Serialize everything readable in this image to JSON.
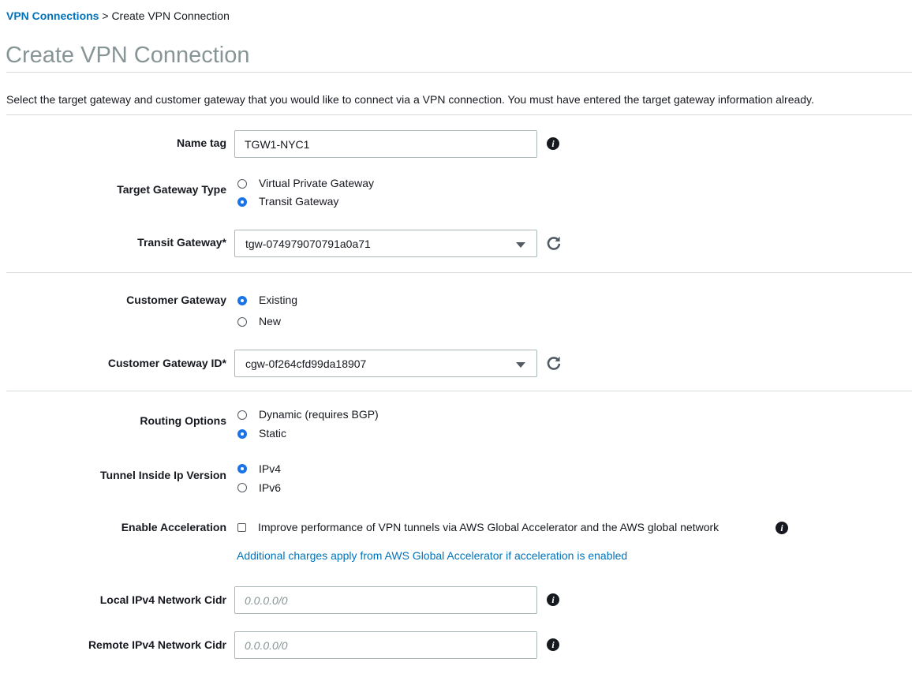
{
  "breadcrumb": {
    "parent": "VPN Connections",
    "separator": " > ",
    "current": "Create VPN Connection"
  },
  "page": {
    "title": "Create VPN Connection",
    "description": "Select the target gateway and customer gateway that you would like to connect via a VPN connection. You must have entered the target gateway information already."
  },
  "form": {
    "name_tag": {
      "label": "Name tag",
      "value": "TGW1-NYC1",
      "info_icon": "info-icon"
    },
    "target_gateway_type": {
      "label": "Target Gateway Type",
      "options": [
        "Virtual Private Gateway",
        "Transit Gateway"
      ],
      "selected": "Transit Gateway"
    },
    "transit_gateway": {
      "label": "Transit Gateway*",
      "value": "tgw-074979070791a0a71",
      "refresh_icon": "refresh-icon"
    },
    "customer_gateway": {
      "label": "Customer Gateway",
      "options": [
        "Existing",
        "New"
      ],
      "selected": "Existing"
    },
    "customer_gateway_id": {
      "label": "Customer Gateway ID*",
      "value": "cgw-0f264cfd99da18907",
      "refresh_icon": "refresh-icon"
    },
    "routing_options": {
      "label": "Routing Options",
      "options": [
        "Dynamic (requires BGP)",
        "Static"
      ],
      "selected": "Static"
    },
    "tunnel_ip_version": {
      "label": "Tunnel Inside Ip Version",
      "options": [
        "IPv4",
        "IPv6"
      ],
      "selected": "IPv4"
    },
    "enable_acceleration": {
      "label": "Enable Acceleration",
      "checkbox_label": "Improve performance of VPN tunnels via AWS Global Accelerator and the AWS global network",
      "checked": false,
      "note": "Additional charges apply from AWS Global Accelerator if acceleration is enabled"
    },
    "local_cidr": {
      "label": "Local IPv4 Network Cidr",
      "value": "",
      "placeholder": "0.0.0.0/0"
    },
    "remote_cidr": {
      "label": "Remote IPv4 Network Cidr",
      "value": "",
      "placeholder": "0.0.0.0/0"
    }
  },
  "colors": {
    "link": "#0073bb",
    "radio_selected": "#1a73e8",
    "title": "#879596",
    "divider": "#d5dbdb"
  }
}
